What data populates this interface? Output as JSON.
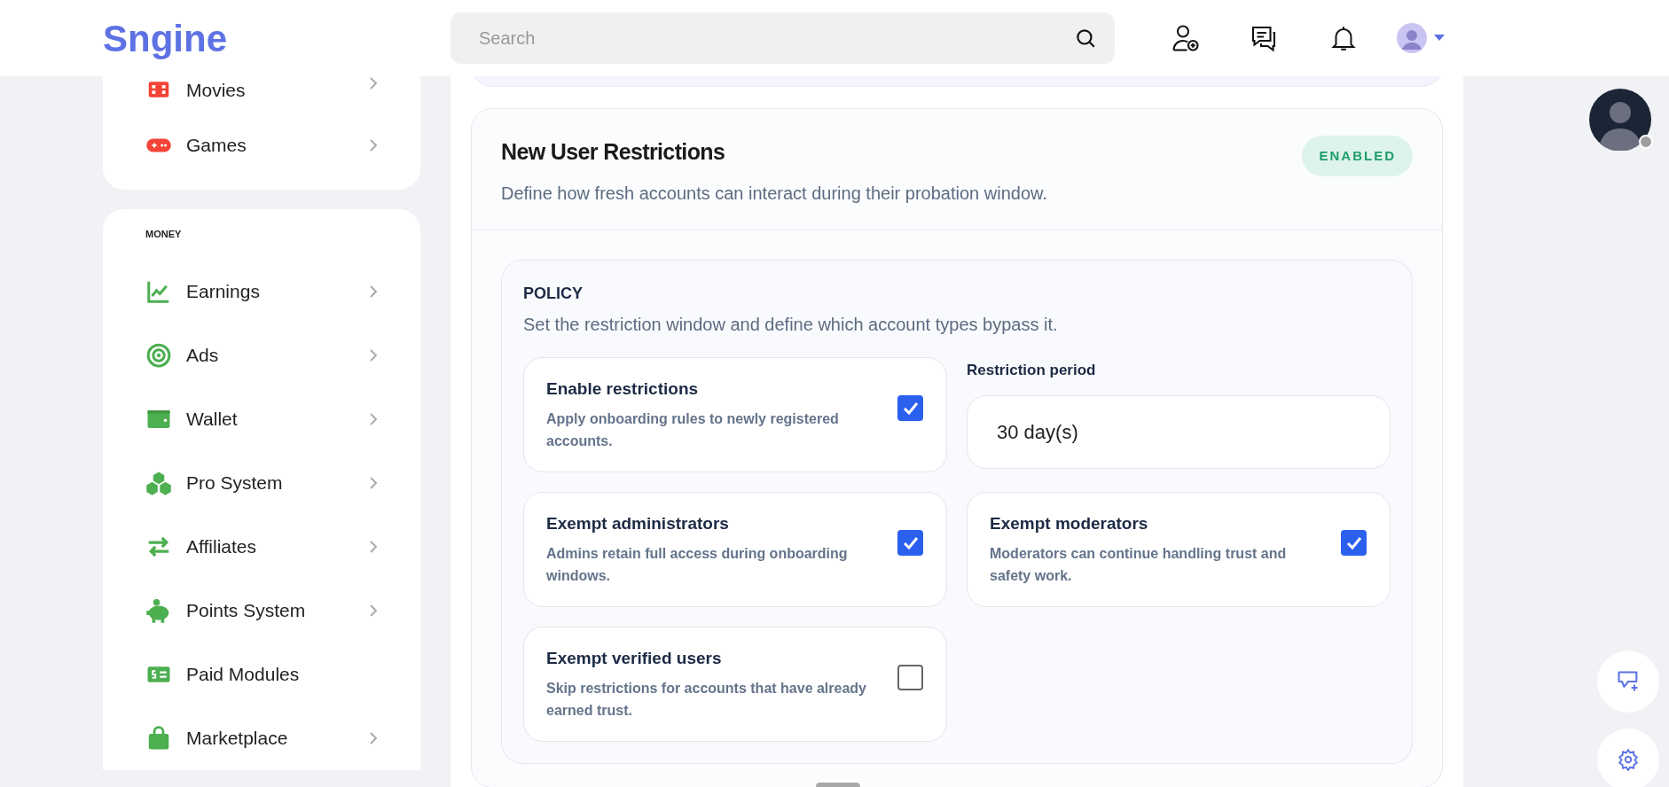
{
  "header": {
    "logo": "Sngine",
    "search": {
      "placeholder": "Search"
    }
  },
  "sidebar": {
    "groups": [
      {
        "items": [
          {
            "label": "Movies",
            "has_submenu": true
          },
          {
            "label": "Games",
            "has_submenu": true
          }
        ]
      },
      {
        "title": "MONEY",
        "items": [
          {
            "label": "Earnings",
            "has_submenu": true
          },
          {
            "label": "Ads",
            "has_submenu": true
          },
          {
            "label": "Wallet",
            "has_submenu": true
          },
          {
            "label": "Pro System",
            "has_submenu": true
          },
          {
            "label": "Affiliates",
            "has_submenu": true
          },
          {
            "label": "Points System",
            "has_submenu": true
          },
          {
            "label": "Paid Modules",
            "has_submenu": false
          },
          {
            "label": "Marketplace",
            "has_submenu": true
          }
        ]
      }
    ]
  },
  "section": {
    "title": "New User Restrictions",
    "badge": "ENABLED",
    "description": "Define how fresh accounts can interact during their probation window.",
    "policy": {
      "title": "POLICY",
      "description": "Set the restriction window and define which account types bypass it.",
      "fields": [
        {
          "kind": "checkbox",
          "title": "Enable restrictions",
          "description": "Apply onboarding rules to newly registered accounts.",
          "checked": true
        },
        {
          "kind": "input",
          "label": "Restriction period",
          "value": "30 day(s)"
        },
        {
          "kind": "checkbox",
          "title": "Exempt administrators",
          "description": "Admins retain full access during onboarding windows.",
          "checked": true
        },
        {
          "kind": "checkbox",
          "title": "Exempt moderators",
          "description": "Moderators can continue handling trust and safety work.",
          "checked": true
        },
        {
          "kind": "checkbox",
          "title": "Exempt verified users",
          "description": "Skip restrictions for accounts that have already earned trust.",
          "checked": false
        }
      ]
    }
  }
}
